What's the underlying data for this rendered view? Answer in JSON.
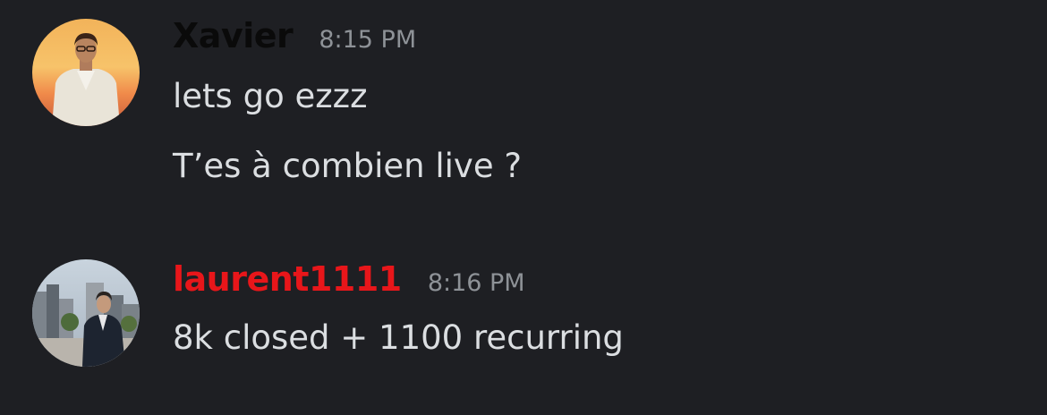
{
  "colors": {
    "background": "#1e1f23",
    "text": "#dbdee1",
    "timestamp": "#8e9297",
    "username_xavier": "#0a0a0a",
    "username_laurent": "#e8161a"
  },
  "messages": [
    {
      "author": "Xavier",
      "time": "8:15 PM",
      "avatar_icon": "user-avatar-sunset",
      "lines": [
        "lets go ezzz",
        "T’es à combien live ?"
      ]
    },
    {
      "author": "laurent1111",
      "time": "8:16 PM",
      "avatar_icon": "user-avatar-city",
      "lines": [
        "8k closed + 1100 recurring"
      ]
    }
  ]
}
